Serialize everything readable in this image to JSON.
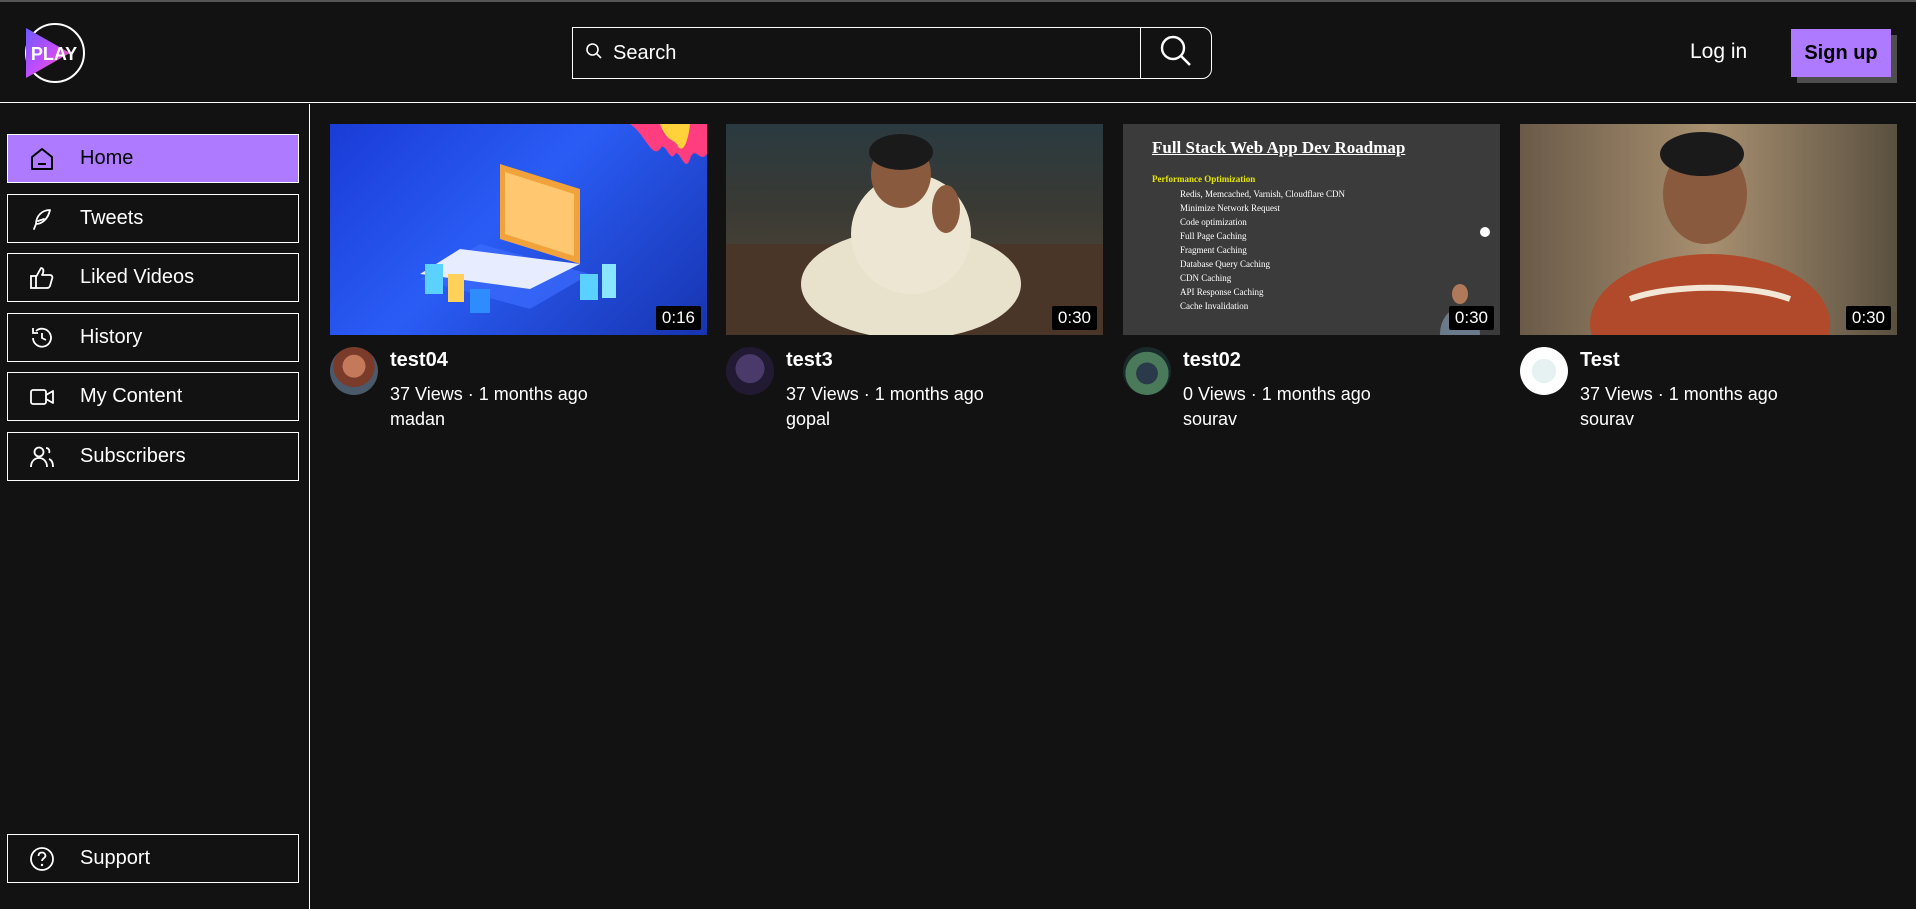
{
  "header": {
    "logo_text": "PLAY",
    "search_placeholder": "Search",
    "login_label": "Log in",
    "signup_label": "Sign up"
  },
  "colors": {
    "accent": "#ae7aff",
    "background": "#121212",
    "border": "#ffffff"
  },
  "sidebar": {
    "items": [
      {
        "label": "Home",
        "icon": "home-icon",
        "active": true
      },
      {
        "label": "Tweets",
        "icon": "feather-icon",
        "active": false
      },
      {
        "label": "Liked Videos",
        "icon": "thumbs-up-icon",
        "active": false
      },
      {
        "label": "History",
        "icon": "history-icon",
        "active": false
      },
      {
        "label": "My Content",
        "icon": "video-camera-icon",
        "active": false
      },
      {
        "label": "Subscribers",
        "icon": "users-icon",
        "active": false
      }
    ],
    "support": {
      "label": "Support",
      "icon": "help-circle-icon"
    }
  },
  "videos": [
    {
      "title": "test04",
      "stats": "37 Views · 1 months ago",
      "channel": "madan",
      "duration": "0:16"
    },
    {
      "title": "test3",
      "stats": "37 Views · 1 months ago",
      "channel": "gopal",
      "duration": "0:30"
    },
    {
      "title": "test02",
      "stats": "0 Views · 1 months ago",
      "channel": "sourav",
      "duration": "0:30",
      "slide": {
        "heading": "Full Stack Web App Dev Roadmap",
        "subheading": "Performance Optimization",
        "lines": [
          "Redis, Memcached, Varnish, Cloudflare CDN",
          "Minimize Network Request",
          "Code optimization",
          "Full Page Caching",
          "Fragment Caching",
          "Database Query Caching",
          "CDN Caching",
          "API Response Caching",
          "Cache Invalidation"
        ]
      }
    },
    {
      "title": "Test",
      "stats": "37 Views · 1 months ago",
      "channel": "sourav",
      "duration": "0:30"
    }
  ]
}
